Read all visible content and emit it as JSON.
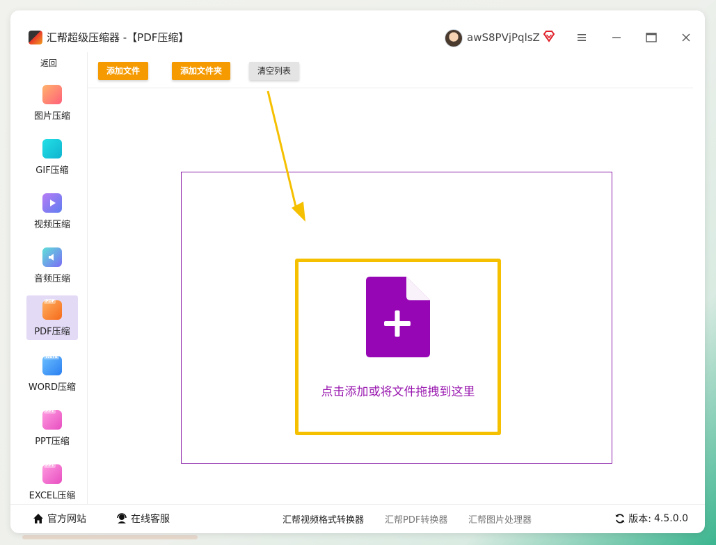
{
  "window": {
    "title": "汇帮超级压缩器  -【PDF压缩】",
    "username": "awS8PVjPqlsZ"
  },
  "sidebar": {
    "back_label": "返回",
    "items": [
      {
        "label": "图片压缩",
        "icon": "image-icon",
        "color": "#ff6b6b"
      },
      {
        "label": "GIF压缩",
        "icon": "gif-icon",
        "color": "#19c6d8"
      },
      {
        "label": "视频压缩",
        "icon": "video-icon",
        "color": "#8b6cf0"
      },
      {
        "label": "音频压缩",
        "icon": "audio-icon",
        "color": "#6a8cf5"
      },
      {
        "label": "PDF压缩",
        "icon": "pdf-icon",
        "color": "#f5852a",
        "tag": "PDF",
        "active": true
      },
      {
        "label": "WORD压缩",
        "icon": "word-icon",
        "color": "#3a8ef0",
        "tag": "Word"
      },
      {
        "label": "PPT压缩",
        "icon": "ppt-icon",
        "color": "#ef5fc7",
        "tag": "PPT"
      },
      {
        "label": "EXCEL压缩",
        "icon": "excel-icon",
        "color": "#ef5fc7",
        "tag": "PPT"
      }
    ]
  },
  "toolbar": {
    "add_file": "添加文件",
    "add_folder": "添加文件夹",
    "clear_list": "清空列表"
  },
  "dropzone": {
    "text": "点击添加或将文件拖拽到这里",
    "accent": "#9a1ab0",
    "border": "#f5c000"
  },
  "footer": {
    "website": "官方网站",
    "support": "在线客服",
    "link1": "汇帮视频格式转换器",
    "link2": "汇帮PDF转换器",
    "link3": "汇帮图片处理器",
    "version_label": "版本:",
    "version": "4.5.0.0"
  }
}
